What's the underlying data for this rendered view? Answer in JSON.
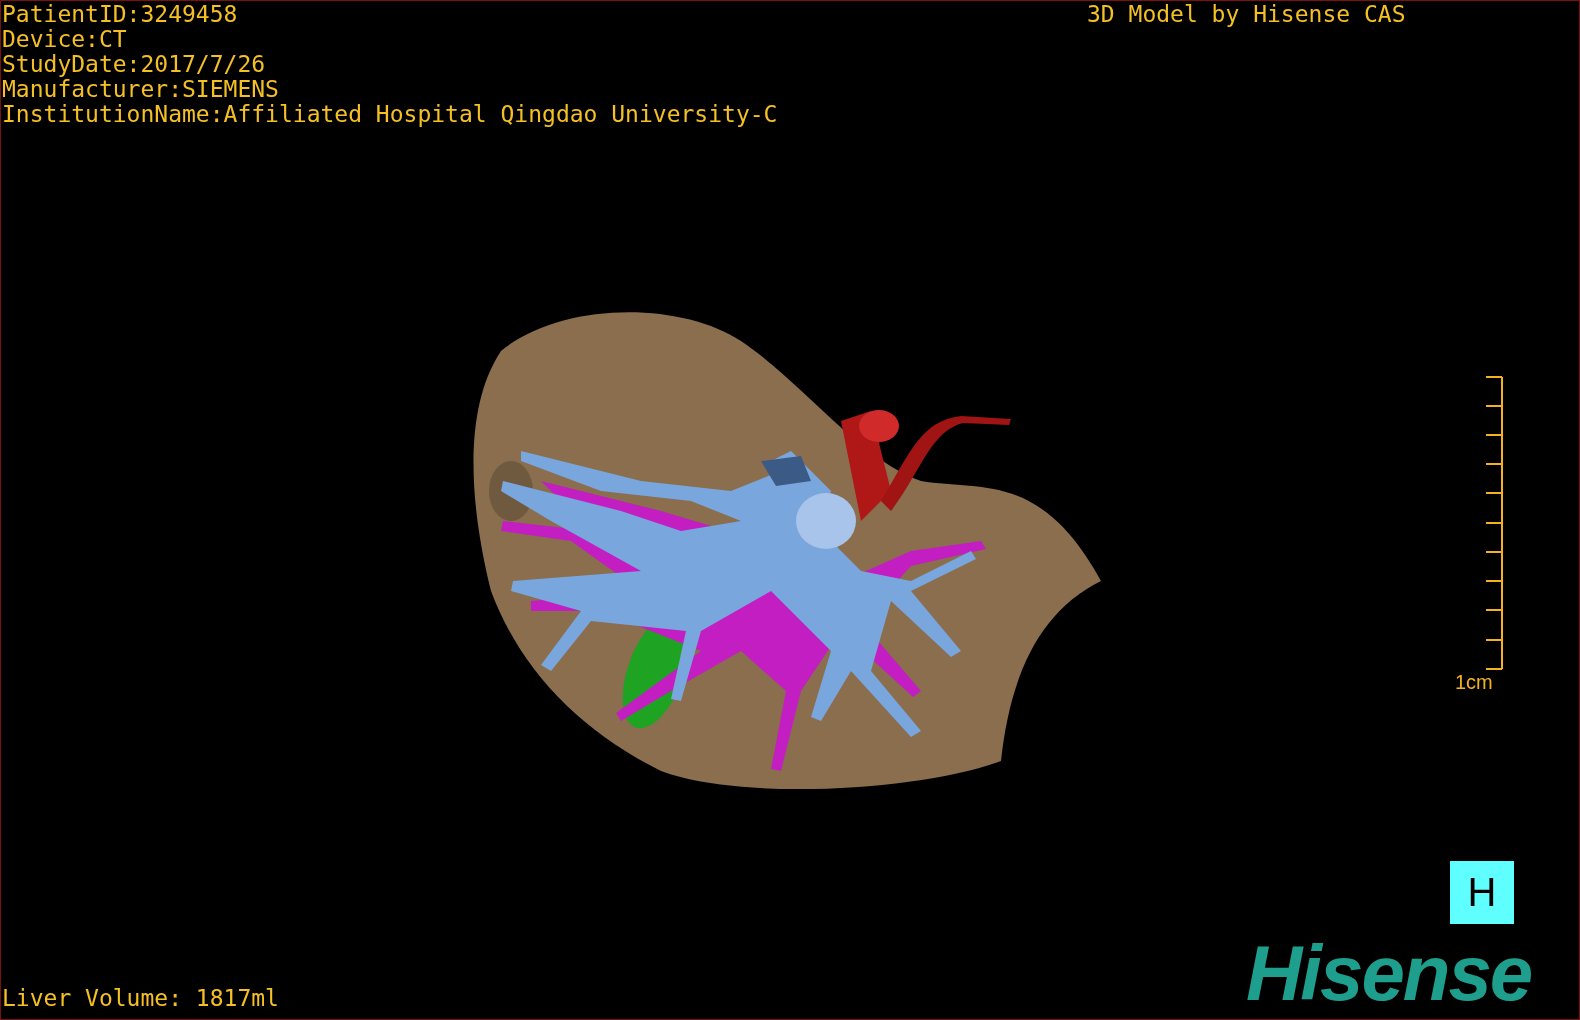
{
  "patient_info": [
    "PatientID:3249458",
    "Device:CT",
    "StudyDate:2017/7/26",
    "Manufacturer:SIEMENS",
    "InstitutionName:Affiliated Hospital Qingdao University-C"
  ],
  "model_credit": "3D Model by Hisense CAS",
  "scale_bar": {
    "label": "1cm"
  },
  "orientation_marker": "H",
  "liver_volume": "Liver Volume: 1817ml",
  "logo": "Hisense"
}
